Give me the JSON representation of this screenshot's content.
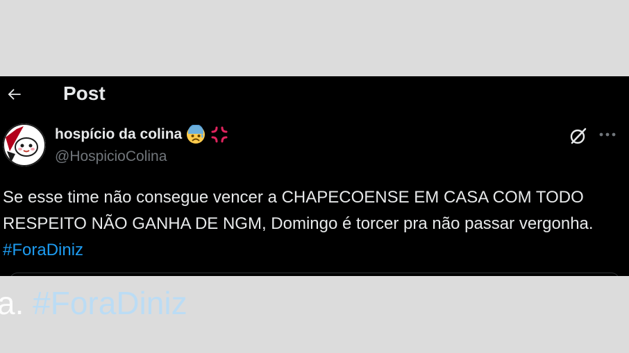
{
  "header": {
    "title": "Post"
  },
  "post": {
    "author": {
      "display_name": "hospício da colina",
      "handle": "@HospicioColina",
      "emojis": [
        "anxious-face-with-sweat",
        "anger-symbol"
      ]
    },
    "text": "Se esse time não consegue vencer a CHAPECOENSE EM CASA COM TODO RESPEITO NÃO GANHA DE NGM, Domingo é torcer pra não passar vergonha. ",
    "hashtag": "#ForaDiniz"
  },
  "zoom_overlay": {
    "prefix": "a. ",
    "hashtag": "#ForaDiniz"
  },
  "colors": {
    "background": "#000000",
    "text": "#e7e9ea",
    "secondary_text": "#71767b",
    "link": "#1d9bf0"
  },
  "icons": [
    "back-arrow-icon",
    "grok-icon",
    "more-icon"
  ]
}
